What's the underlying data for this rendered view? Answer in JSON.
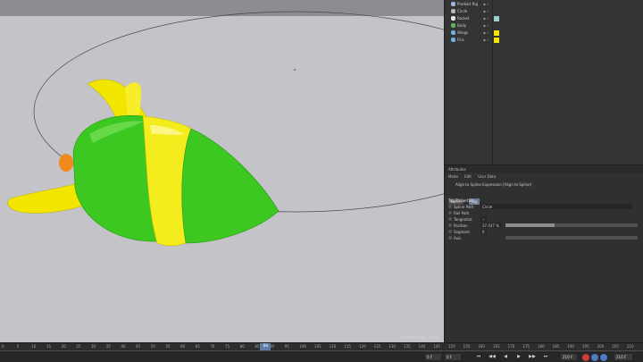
{
  "viewport": {
    "status_text": "75 Markierung  20 OS"
  },
  "object_manager": {
    "items": [
      {
        "name": "Produkt Rig",
        "color": "#9cb6d8"
      },
      {
        "name": "Circle",
        "color": "#b7b7b7"
      },
      {
        "name": "Rocket",
        "color": "#e8e8e8"
      },
      {
        "name": "Body",
        "color": "#5db35b"
      },
      {
        "name": "Wings",
        "color": "#6fb1e8"
      },
      {
        "name": "Fins",
        "color": "#6fb1e8"
      }
    ]
  },
  "attributes": {
    "header": "Attributes",
    "menu": [
      "Mode",
      "Edit",
      "User Data"
    ],
    "tag_title": "Align to Spline Expression [Align to Spline]",
    "tabs": [
      {
        "label": "Basic",
        "active": false
      },
      {
        "label": "Tag",
        "active": true
      }
    ],
    "section_title": "Tag Properties",
    "props": [
      {
        "label": "Spline Path",
        "value": "Circle",
        "slider": null
      },
      {
        "label": "Rail Path",
        "value": "",
        "slider": null
      },
      {
        "label": "Tangential",
        "value": "✓",
        "slider": null
      },
      {
        "label": "Position",
        "value": "37.037 %",
        "slider": 0.37
      },
      {
        "label": "Segment",
        "value": "0",
        "slider": null
      },
      {
        "label": "Axis",
        "value": "",
        "slider": 0.0
      }
    ]
  },
  "timeline": {
    "ticks": [
      "0",
      "5",
      "10",
      "15",
      "20",
      "25",
      "30",
      "35",
      "40",
      "45",
      "50",
      "55",
      "60",
      "65",
      "70",
      "75",
      "80",
      "85",
      "90",
      "95",
      "100",
      "105",
      "110",
      "115",
      "120",
      "125",
      "130",
      "135",
      "140",
      "145",
      "150",
      "155",
      "160",
      "165",
      "170",
      "175",
      "180",
      "185",
      "190",
      "195",
      "200",
      "205",
      "210"
    ],
    "current_frame": "88",
    "field_left": "0 F",
    "field_start": "0 F",
    "field_end": "210 F",
    "field_right": "210 F",
    "accent_color": "#5c7ea8",
    "controls": [
      "⏮",
      "◀◀",
      "◀",
      "▶",
      "▶▶",
      "⏭"
    ]
  }
}
